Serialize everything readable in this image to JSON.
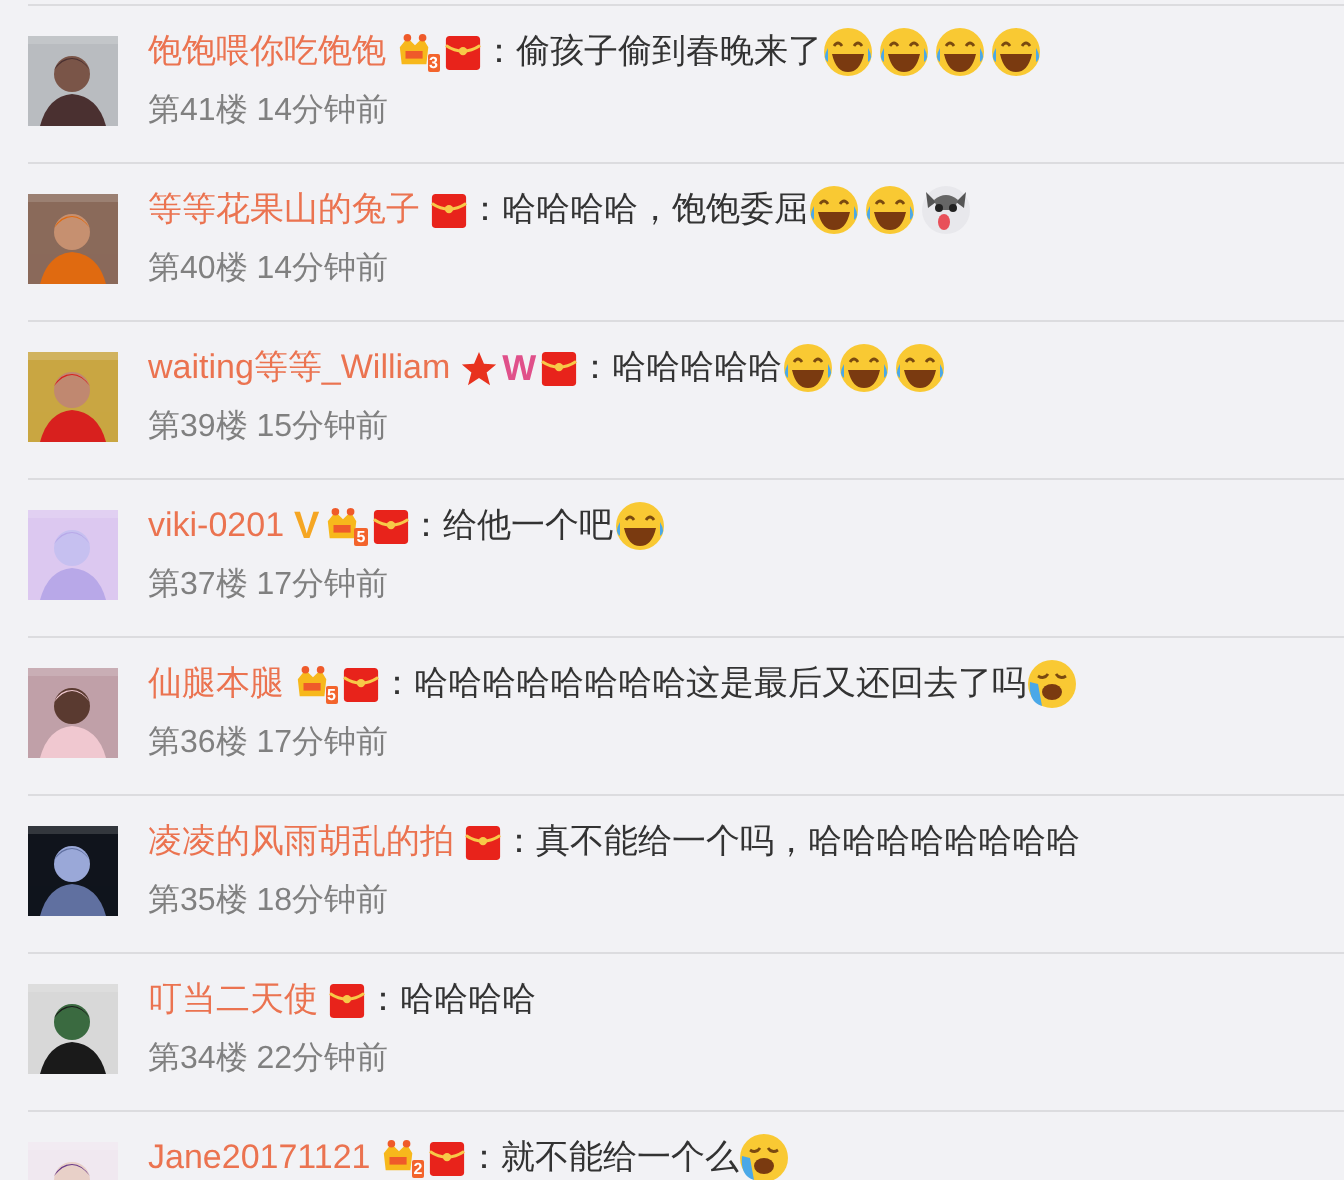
{
  "comments": [
    {
      "name": "饱饱喂你吃饱饱",
      "badges": [
        {
          "kind": "crown",
          "label": "3"
        },
        {
          "kind": "redpacket"
        }
      ],
      "text": "：偷孩子偷到春晚来了",
      "emojis": [
        {
          "kind": "laugh"
        },
        {
          "kind": "laugh"
        },
        {
          "kind": "laugh"
        },
        {
          "kind": "laugh"
        }
      ],
      "floor": "第41楼",
      "time": "14分钟前"
    },
    {
      "name": "等等花果山的兔子",
      "badges": [
        {
          "kind": "redpacket"
        }
      ],
      "text": "：哈哈哈哈，饱饱委屈",
      "emojis": [
        {
          "kind": "laugh"
        },
        {
          "kind": "laugh"
        },
        {
          "kind": "dog"
        }
      ],
      "floor": "第40楼",
      "time": "14分钟前"
    },
    {
      "name": "waiting等等_William",
      "badges": [
        {
          "kind": "star"
        },
        {
          "kind": "letter",
          "label": "W"
        },
        {
          "kind": "redpacket"
        }
      ],
      "text": "：哈哈哈哈哈",
      "emojis": [
        {
          "kind": "laugh"
        },
        {
          "kind": "laugh"
        },
        {
          "kind": "laugh"
        }
      ],
      "floor": "第39楼",
      "time": "15分钟前"
    },
    {
      "name": "viki-0201",
      "badges": [
        {
          "kind": "vip",
          "label": "V"
        },
        {
          "kind": "crown",
          "label": "5"
        },
        {
          "kind": "redpacket"
        }
      ],
      "text": "：给他一个吧",
      "emojis": [
        {
          "kind": "laugh"
        }
      ],
      "floor": "第37楼",
      "time": "17分钟前"
    },
    {
      "name": "仙腿本腿",
      "badges": [
        {
          "kind": "crown",
          "label": "5"
        },
        {
          "kind": "redpacket"
        }
      ],
      "text": "：哈哈哈哈哈哈哈哈这是最后又还回去了吗",
      "emojis": [
        {
          "kind": "cry"
        }
      ],
      "floor": "第36楼",
      "time": "17分钟前"
    },
    {
      "name": "凌凌的风雨胡乱的拍",
      "badges": [
        {
          "kind": "redpacket"
        }
      ],
      "text": "：真不能给一个吗，哈哈哈哈哈哈哈哈",
      "floor": "第35楼",
      "time": "18分钟前"
    },
    {
      "name": "叮当二天使",
      "badges": [
        {
          "kind": "redpacket"
        }
      ],
      "text": "：哈哈哈哈",
      "floor": "第34楼",
      "time": "22分钟前"
    },
    {
      "name": "Jane20171121",
      "badges": [
        {
          "kind": "crown",
          "label": "2"
        },
        {
          "kind": "redpacket"
        }
      ],
      "text": "：就不能给一个么",
      "emojis": [
        {
          "kind": "cry"
        }
      ]
    }
  ]
}
